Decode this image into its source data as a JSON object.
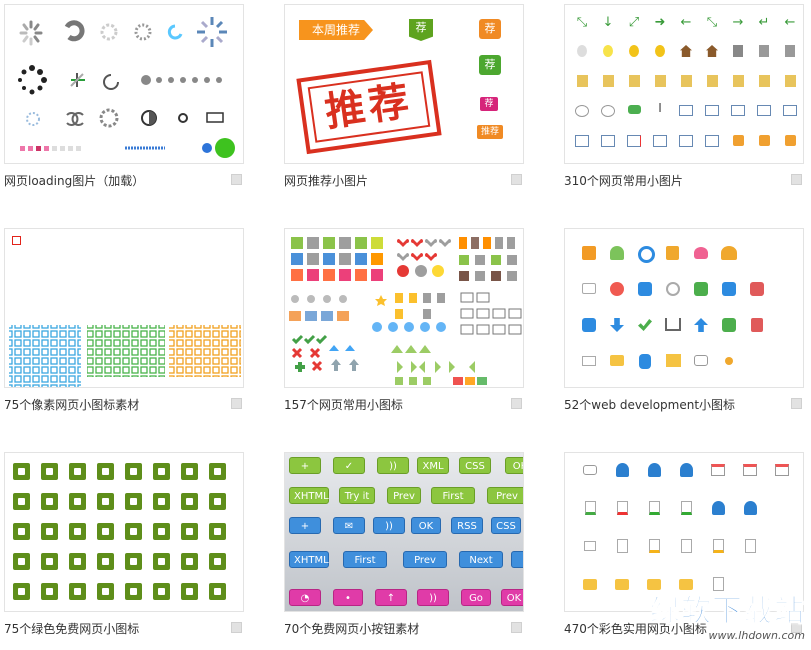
{
  "cards": [
    {
      "caption": "网页loading图片（加载）"
    },
    {
      "caption": "网页推荐小图片"
    },
    {
      "caption": "310个网页常用小图片"
    },
    {
      "caption": "75个像素网页小图标素材"
    },
    {
      "caption": "157个网页常用小图标"
    },
    {
      "caption": "52个web development小图标"
    },
    {
      "caption": "75个绿色免费网页小图标"
    },
    {
      "caption": "70个免费网页小按钮素材"
    },
    {
      "caption": "470个彩色实用网页小图标"
    }
  ],
  "recommend": {
    "ribbon": "本周推荐",
    "stamp": "推荐",
    "tags": [
      "荐",
      "荐",
      "荐",
      "荐",
      "推荐"
    ]
  },
  "buttons": {
    "row1": [
      "",
      "",
      "",
      "XML",
      "CSS",
      "OK"
    ],
    "row2": [
      "XHTML",
      "Try it",
      "Prev",
      "First",
      "Prev"
    ],
    "row3": [
      "",
      "",
      "",
      "OK",
      "RSS",
      "CSS"
    ],
    "row4": [
      "XHTML",
      "First",
      "Prev",
      "Next",
      ""
    ],
    "row5": [
      "",
      "",
      "",
      "",
      "Go",
      "OK"
    ]
  },
  "watermark": {
    "title": "绿软下载站",
    "url": "www.lhdown.com"
  },
  "colors": {
    "green": "#5e8e1a",
    "red": "#e2231a",
    "blue": "#3f8fdc",
    "orange": "#f39c12",
    "stampRed": "#d9301f"
  }
}
